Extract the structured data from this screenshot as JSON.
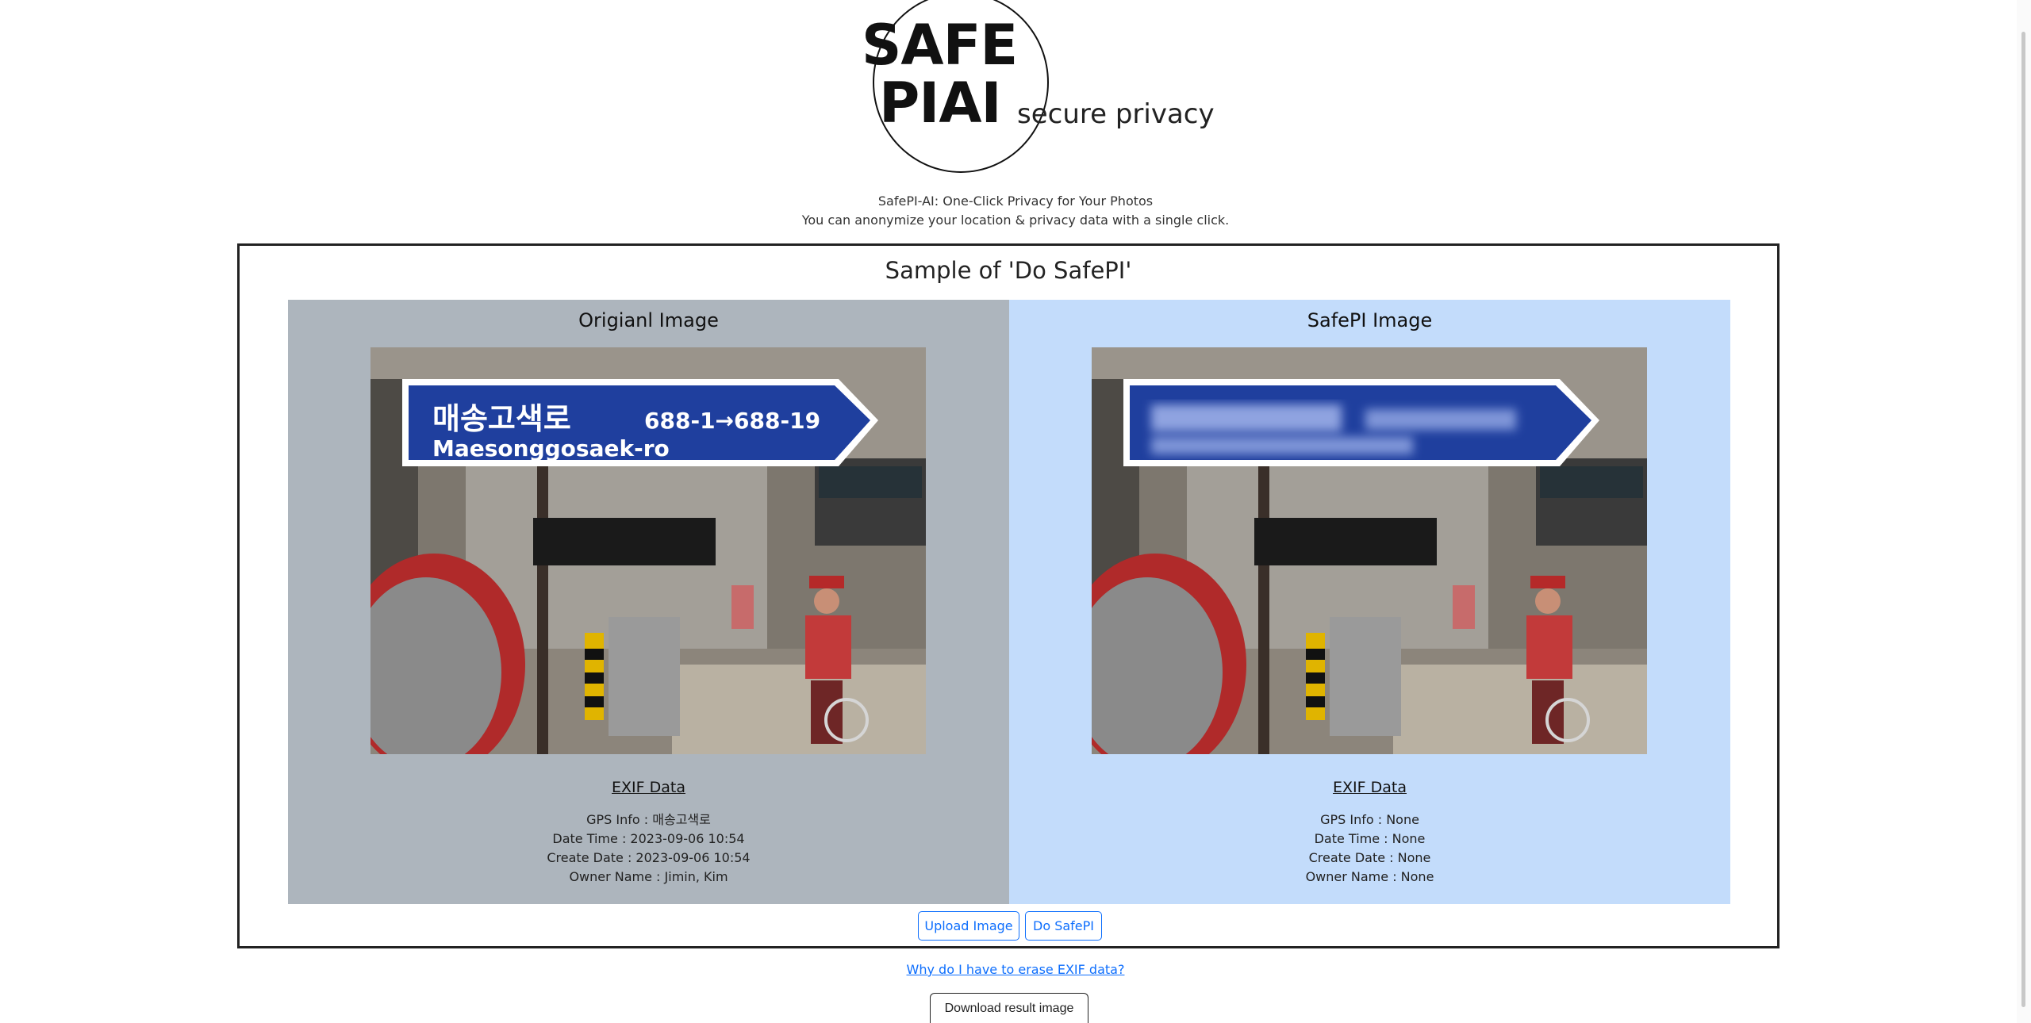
{
  "brand": {
    "logo_line1": "SAFE",
    "logo_line2": "PIAI",
    "tagline": "secure privacy"
  },
  "intro": {
    "line1": "SafePI-AI: One-Click Privacy for Your Photos",
    "line2": "You can anonymize your location & privacy data with a single click."
  },
  "sample": {
    "title": "Sample of 'Do SafePI'",
    "original": {
      "title": "Origianl Image",
      "sign_korean": "매송고색로",
      "sign_numbers": "688-1→688-19",
      "sign_roman": "Maesonggosaek-ro",
      "exif_title": "EXIF Data",
      "exif": [
        "GPS Info : 매송고색로",
        "Date Time : 2023-09-06 10:54",
        "Create Date : 2023-09-06 10:54",
        "Owner Name : Jimin, Kim"
      ]
    },
    "safepi": {
      "title": "SafePI Image",
      "exif_title": "EXIF Data",
      "exif": [
        "GPS Info : None",
        "Date Time : None",
        "Create Date : None",
        "Owner Name : None"
      ]
    },
    "buttons": {
      "upload": "Upload Image",
      "safepi": "Do SafePI"
    }
  },
  "links": {
    "why_exif": "Why do I have to erase EXIF data?"
  },
  "download": {
    "label": "Download result image"
  },
  "colors": {
    "original_panel": "#adb5bd",
    "safepi_panel": "#c3dcfb",
    "button_accent": "#0d6efd",
    "sign_blue": "#1f3f9e"
  }
}
